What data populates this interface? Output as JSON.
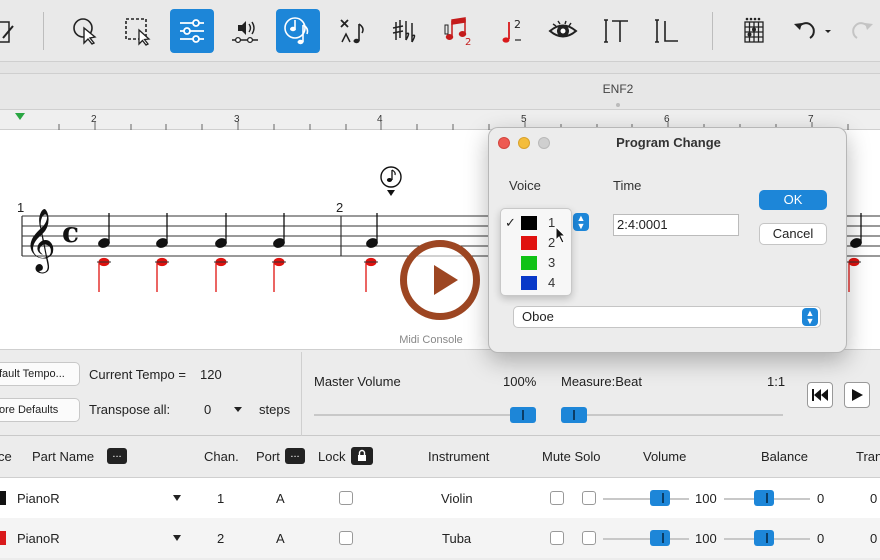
{
  "document": {
    "title": "ENF2"
  },
  "ruler": {
    "numbers": [
      "2",
      "3",
      "4",
      "5",
      "6",
      "7"
    ]
  },
  "score": {
    "measure_1": "1",
    "measure_2": "2"
  },
  "midi_console": {
    "label": "Midi Console"
  },
  "console": {
    "default_tempo_button": "fault Tempo...",
    "restore_defaults_button": "ore Defaults",
    "current_tempo_label": "Current Tempo =",
    "current_tempo_value": "120",
    "transpose_label": "Transpose all:",
    "transpose_value": "0",
    "transpose_unit": "steps",
    "master_volume_label": "Master Volume",
    "master_volume_value": "100%",
    "measure_beat_label": "Measure:Beat",
    "measure_beat_value": "1:1"
  },
  "table": {
    "headers": {
      "voice": "ce",
      "part_name": "Part Name",
      "chan": "Chan.",
      "port": "Port",
      "lock": "Lock",
      "instrument": "Instrument",
      "mute_solo": "Mute Solo",
      "volume": "Volume",
      "balance": "Balance",
      "transpose": "Tran"
    },
    "dots_label": "...",
    "rows": [
      {
        "color": "#111111",
        "part": "PianoR",
        "chan": "1",
        "port": "A",
        "instrument": "Violin",
        "volume": "100",
        "balance": "0",
        "transpose": "0"
      },
      {
        "color": "#d9191b",
        "part": "PianoR",
        "chan": "2",
        "port": "A",
        "instrument": "Tuba",
        "volume": "100",
        "balance": "0",
        "transpose": "0"
      }
    ]
  },
  "dialog": {
    "title": "Program Change",
    "voice_label": "Voice",
    "time_label": "Time",
    "time_value": "2:4:0001",
    "ok_label": "OK",
    "cancel_label": "Cancel",
    "instrument_value": "Oboe",
    "voice_menu": [
      {
        "num": "1",
        "color": "#000000",
        "checked": "✓"
      },
      {
        "num": "2",
        "color": "#e0120f"
      },
      {
        "num": "3",
        "color": "#10c216"
      },
      {
        "num": "4",
        "color": "#0838c8"
      }
    ]
  },
  "colors": {
    "accent": "#1d86d8",
    "note_red": "#e0120f",
    "play_overlay": "#9d4622"
  }
}
